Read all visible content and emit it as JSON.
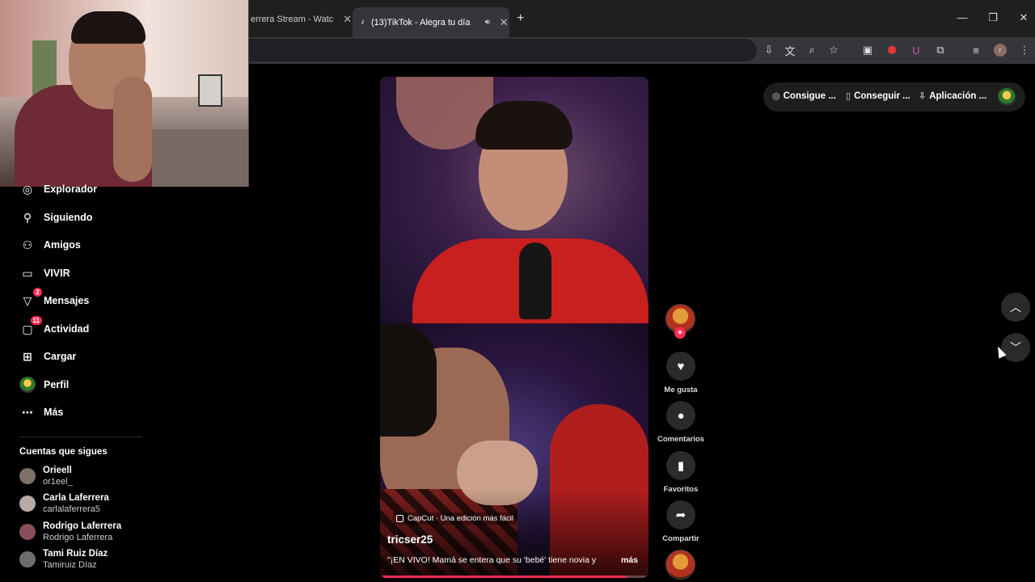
{
  "browser": {
    "tabs": [
      {
        "title": "errera Stream - Watc",
        "close": "✕"
      },
      {
        "title": "(13)TikTok - Alegra tu día",
        "close": "✕"
      }
    ],
    "new_tab": "+",
    "window_controls": {
      "minimize": "—",
      "maximize": "❐",
      "close": "✕"
    },
    "profile_initial": "r"
  },
  "sidebar": {
    "items": [
      {
        "label": "Explorador",
        "icon": "compass-icon"
      },
      {
        "label": "Siguiendo",
        "icon": "person-follow-icon"
      },
      {
        "label": "Amigos",
        "icon": "friends-icon"
      },
      {
        "label": "VIVIR",
        "icon": "live-tv-icon"
      },
      {
        "label": "Mensajes",
        "icon": "send-icon",
        "badge": "2"
      },
      {
        "label": "Actividad",
        "icon": "inbox-icon",
        "badge": "11"
      },
      {
        "label": "Cargar",
        "icon": "upload-plus-icon"
      },
      {
        "label": "Perfil",
        "icon": "profile-avatar"
      },
      {
        "label": "Más",
        "icon": "more-dots-icon"
      }
    ],
    "following_title": "Cuentas que sigues",
    "accounts": [
      {
        "name": "Orieell",
        "user": "or1eel_"
      },
      {
        "name": "Carla Laferrera",
        "user": "carlalaferrera5"
      },
      {
        "name": "Rodrigo Laferrera",
        "user": "Rodrigo Laferrera"
      },
      {
        "name": "Tami Ruiz Díaz",
        "user": "Tamiruiz Díaz"
      }
    ]
  },
  "video": {
    "capcut": "CapCut · Una edición más fácil",
    "author": "tricser25",
    "description": "\"¡EN VIVO! Mamá se entera que su 'bebé' tiene novia y",
    "more": "más",
    "progress": 0.92
  },
  "actions": {
    "like_label": "Me gusta",
    "comments_label": "Comentarios",
    "favorites_label": "Favoritos",
    "share_label": "Compartir"
  },
  "top_bar": {
    "item1": "Consigue ...",
    "item2": "Conseguir ...",
    "item3": "Aplicación ..."
  },
  "colors": {
    "accent": "#fe2c55",
    "background": "#000000"
  }
}
